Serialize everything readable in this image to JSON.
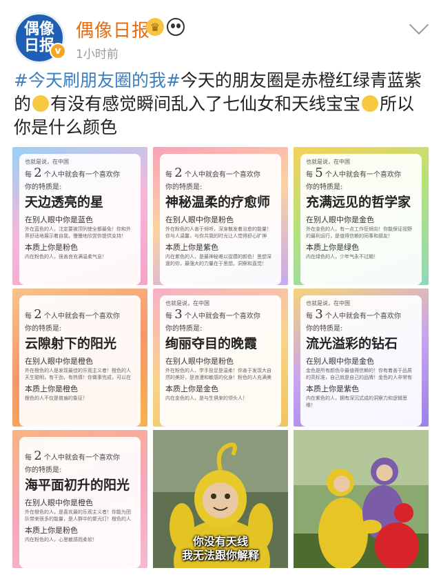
{
  "header": {
    "avatar_text_line1": "偶像",
    "avatar_text_line2": "日报",
    "verified_mark": "v",
    "username": "偶像日报",
    "crown_badge": "♛",
    "time": "1小时前"
  },
  "post": {
    "hashtag": "#今天刷朋友圈的我#",
    "text_part1": "今天的朋友圈是赤橙红绿青蓝紫的",
    "text_part2": "有没有感觉瞬间乱入了七仙女和天线宝宝",
    "text_part3": "所以你是什么颜色"
  },
  "cards": [
    {
      "top_note": "也就是说，在中国",
      "count_pre": "每",
      "count_num": "2",
      "count_post": "个人中就会有一个喜欢你",
      "trait_label": "你的特质是:",
      "title": "天边透亮的星",
      "others_see": "在别人眼中你是蓝色",
      "others_desc": "外在蓝色的人，注定要被顶列使全都最免！你和外界舒适地展示着自我，慢慢地欣赏你提供支持！",
      "essence": "本质上你是粉色",
      "essence_desc": "内在粉色的人，很善良充满温柔气息！"
    },
    {
      "top_note": "",
      "count_pre": "每",
      "count_num": "2",
      "count_post": "个人中就会有一个喜欢你",
      "trait_label": "你的特质是:",
      "title": "神秘温柔的疗愈师",
      "others_see": "在别人眼中你是粉色",
      "others_desc": "外在粉色的人善于倾听，深身散发着治愈的能量！你与人温馨，与你共我的时光让人觉得舒心旷神怡！",
      "essence": "本质上你是紫色",
      "essence_desc": "内在紫色的人，是最神秘难以捉摸的颜色！思想深邃的你，最强大的力量在于思想。洞察和直觉！"
    },
    {
      "top_note": "也就是说，在中国",
      "count_pre": "每",
      "count_num": "5",
      "count_post": "个人中就会有一个喜欢你",
      "trait_label": "你的特质是:",
      "title": "充满远见的哲学家",
      "others_see": "在别人眼中你是金色",
      "others_desc": "外在金色的人，有一点工作狂倾向！你能保证视野的最利运行，是值得信赖的同事和朋友！",
      "essence": "本质上你是绿色",
      "essence_desc": "内在绿色的人，少年气永不过期！"
    },
    {
      "top_note": "",
      "count_pre": "每",
      "count_num": "2",
      "count_post": "个人中就会有一个喜欢你",
      "trait_label": "你的特质是:",
      "title": "云隙射下的阳光",
      "others_see": "在别人眼中你是橙色",
      "others_desc": "外在橙色的人是发现最佳的乐观主义者！橙色的人天生聪明，有干劲，有热情！你做事完成，可以在其余同事需要得要过身的人！",
      "essence": "本质上你是橙色",
      "essence_desc": "橙色的人不仅是普遍的象征！"
    },
    {
      "top_note": "也就是说，在中国",
      "count_pre": "每",
      "count_num": "3",
      "count_post": "个人中就会有一个喜欢你",
      "trait_label": "你的特质是:",
      "title": "绚丽夺目的晚霞",
      "others_see": "在别人眼中你是粉色",
      "others_desc": "外在粉色的人，学手投足是温柔！你善于发现大自然的美好，是浪漫和敏感的化身！粉色的人充满美好，不断向周围人散播着温暖与爱！",
      "essence": "本质上你是金色",
      "essence_desc": "内在金色的人，是与生俱来的领头人！"
    },
    {
      "top_note": "也就是说，在中国",
      "count_pre": "每",
      "count_num": "3",
      "count_post": "个人中就会有一个喜欢你",
      "trait_label": "你的特质是:",
      "title": "流光溢彩的钻石",
      "others_see": "在别人眼中你是金色",
      "others_desc": "金色是所有颜色中最值得信赖的！你有着善于品质的高标准，自己就是自己的品牌！金色的人非常有个人风，拥抱任何的事情可以交心等待好消息！",
      "essence": "本质上你是紫色",
      "essence_desc": "内在紫色的人，拥有深沉式成的洞察力和逻辑思维！"
    },
    {
      "top_note": "",
      "count_pre": "每",
      "count_num": "2",
      "count_post": "个人中就会有一个喜欢你",
      "trait_label": "你的特质是:",
      "title": "海平面初升的阳光",
      "others_see": "在别人眼中你是橙色",
      "others_desc": "外在橙色的人，是喜欢最的乐观主义者！你能为团队带来很多的能量，是人群中的聚光灯！橙色的人喜欢美的魅力，你的无限活力令人惊叹！",
      "essence": "本质上你是粉色",
      "essence_desc": "内在粉色的人，心思敏感而柔软！"
    }
  ],
  "memes": [
    {
      "caption_line1": "你没有天线",
      "caption_line2": "我无法跟你解释"
    },
    {
      "caption_line1": "",
      "caption_line2": ""
    }
  ],
  "colors": {
    "username": "#e86b0f",
    "hashtag": "#3c7ec1",
    "avatar_bg": "#1f5fb5",
    "time": "#999999"
  }
}
